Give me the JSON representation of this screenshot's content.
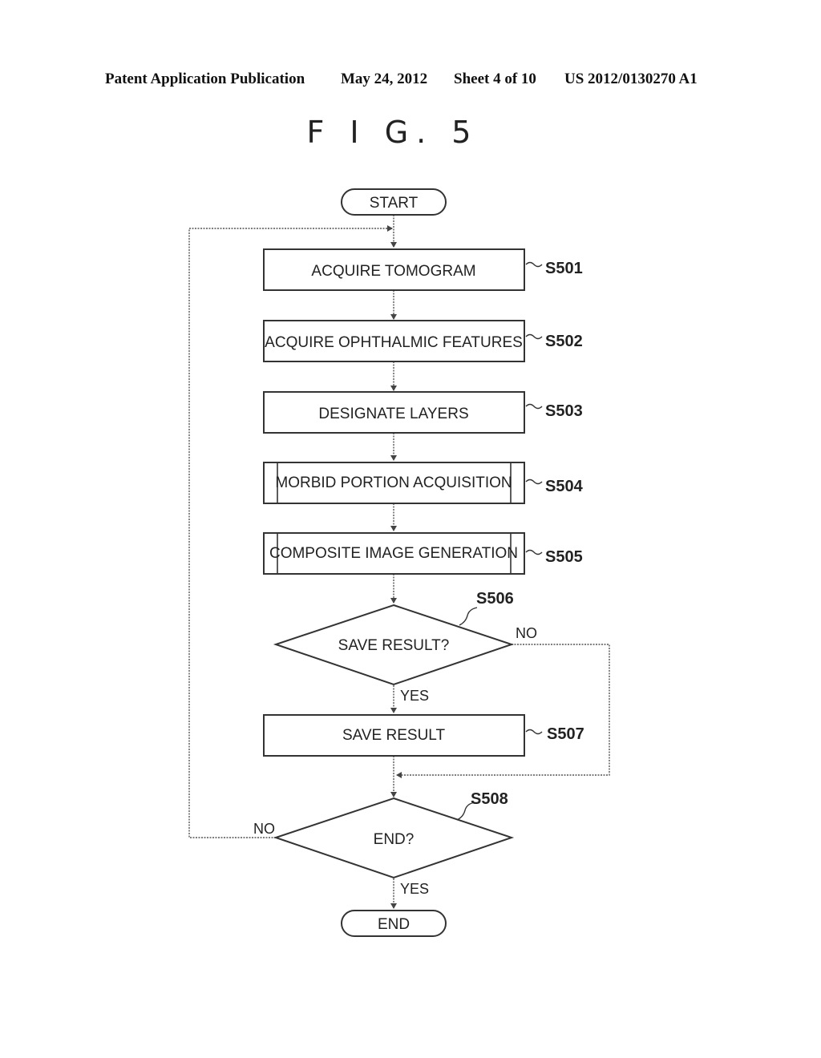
{
  "header": {
    "publication": "Patent Application Publication",
    "date": "May 24, 2012",
    "sheet": "Sheet 4 of 10",
    "number": "US 2012/0130270 A1"
  },
  "figure": {
    "title": "F I G. 5"
  },
  "flowchart": {
    "start": "START",
    "end": "END",
    "steps": [
      {
        "id": "S501",
        "label": "ACQUIRE TOMOGRAM",
        "type": "process"
      },
      {
        "id": "S502",
        "label": "ACQUIRE OPHTHALMIC FEATURES",
        "type": "process"
      },
      {
        "id": "S503",
        "label": "DESIGNATE LAYERS",
        "type": "process"
      },
      {
        "id": "S504",
        "label": "MORBID PORTION ACQUISITION",
        "type": "subroutine"
      },
      {
        "id": "S505",
        "label": "COMPOSITE IMAGE GENERATION",
        "type": "subroutine"
      },
      {
        "id": "S506",
        "label": "SAVE RESULT?",
        "type": "decision",
        "yes": "YES",
        "no": "NO"
      },
      {
        "id": "S507",
        "label": "SAVE RESULT",
        "type": "process"
      },
      {
        "id": "S508",
        "label": "END?",
        "type": "decision",
        "yes": "YES",
        "no": "NO"
      }
    ]
  }
}
